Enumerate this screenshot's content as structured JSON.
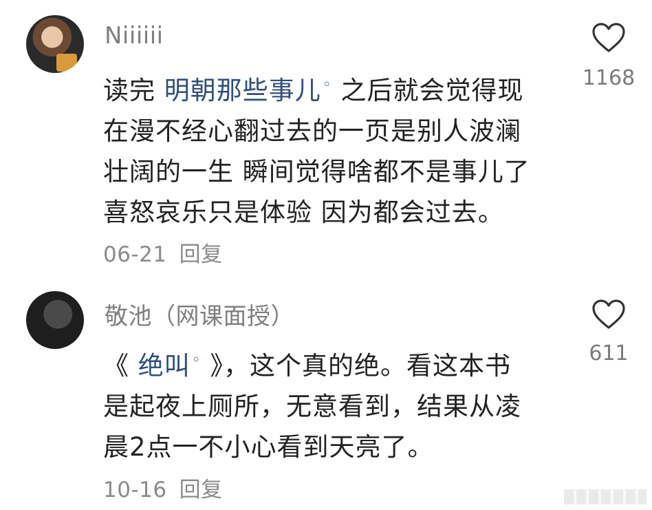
{
  "comments": [
    {
      "username": "Niiiiii",
      "text_before": "读完 ",
      "link_text": "明朝那些事儿",
      "text_after": " 之后就会觉得现在漫不经心翻过去的一页是别人波澜壮阔的一生 瞬间觉得啥都不是事儿了喜怒哀乐只是体验 因为都会过去。",
      "lines_after": [
        "之后就会觉得现",
        "在漫不经心翻过去的一页是别人波澜",
        "壮阔的一生 瞬间觉得啥都不是事儿了",
        "喜怒哀乐只是体验 因为都会过去。"
      ],
      "date": "06-21",
      "reply_label": "回复",
      "likes": "1168"
    },
    {
      "username": "敬池（网课面授）",
      "text_before": "《 ",
      "link_text": "绝叫",
      "lines_after": [
        " 》，这个真的绝。看这本书",
        "是起夜上厕所，无意看到，结果从凌",
        "晨2点一不小心看到天亮了。"
      ],
      "date": "10-16",
      "reply_label": "回复",
      "likes": "611"
    }
  ],
  "icons": {
    "like": "heart-outline-icon",
    "search_link": "search-link-icon"
  },
  "colors": {
    "link": "#2f4f7a",
    "meta": "#8a8a8a",
    "text": "#222222"
  }
}
